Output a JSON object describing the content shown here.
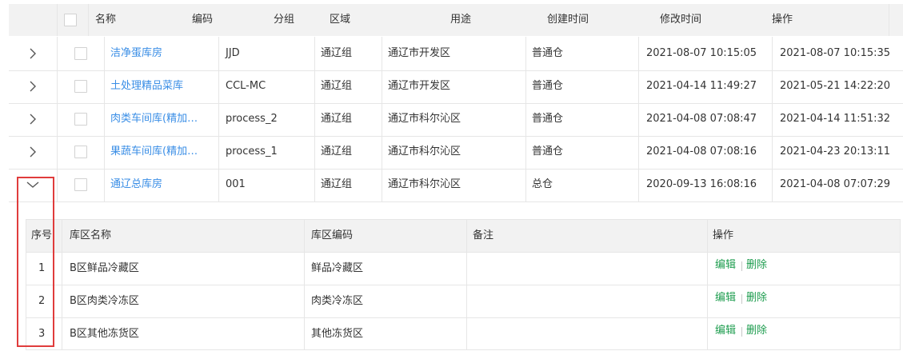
{
  "header": {
    "columns": [
      "名称",
      "编码",
      "分组",
      "区域",
      "用途",
      "创建时间",
      "修改时间",
      "操作"
    ]
  },
  "rows": [
    {
      "name": "洁净蛋库房",
      "code": "JJD",
      "group": "通辽组",
      "region": "通辽市开发区",
      "usage": "普通仓",
      "created": "2021-08-07 10:15:05",
      "modified": "2021-08-07 10:15:35"
    },
    {
      "name": "土处理精品菜库",
      "code": "CCL-MC",
      "group": "通辽组",
      "region": "通辽市开发区",
      "usage": "普通仓",
      "created": "2021-04-14 11:49:27",
      "modified": "2021-05-21 14:22:20"
    },
    {
      "name": "肉类车间库(精加…",
      "code": "process_2",
      "group": "通辽组",
      "region": "通辽市科尔沁区",
      "usage": "普通仓",
      "created": "2021-04-08 07:08:47",
      "modified": "2021-04-14 11:51:32"
    },
    {
      "name": "果蔬车间库(精加…",
      "code": "process_1",
      "group": "通辽组",
      "region": "通辽市科尔沁区",
      "usage": "普通仓",
      "created": "2021-04-08 07:08:16",
      "modified": "2021-04-23 20:13:11"
    },
    {
      "name": "通辽总库房",
      "code": "001",
      "group": "通辽组",
      "region": "通辽市科尔沁区",
      "usage": "总仓",
      "created": "2020-09-13 16:08:16",
      "modified": "2021-04-08 07:07:29"
    }
  ],
  "subtable": {
    "columns": [
      "序号",
      "库区名称",
      "库区编码",
      "备注",
      "操作"
    ],
    "rows": [
      {
        "index": "1",
        "name": "B区鲜品冷藏区",
        "code": "鲜品冷藏区",
        "remark": "",
        "edit": "编辑",
        "delete": "删除"
      },
      {
        "index": "2",
        "name": "B区肉类冷冻区",
        "code": "肉类冷冻区",
        "remark": "",
        "edit": "编辑",
        "delete": "删除"
      },
      {
        "index": "3",
        "name": "B区其他冻货区",
        "code": "其他冻货区",
        "remark": "",
        "edit": "编辑",
        "delete": "删除"
      }
    ]
  },
  "colors": {
    "link": "#3a8ee6",
    "action": "#1e9d4f",
    "highlight": "#e03c3c",
    "header_bg": "#f2f2f2",
    "border": "#e6e6e6"
  },
  "icons": {
    "collapsed": "chevron-right-icon",
    "expanded": "chevron-down-icon"
  }
}
